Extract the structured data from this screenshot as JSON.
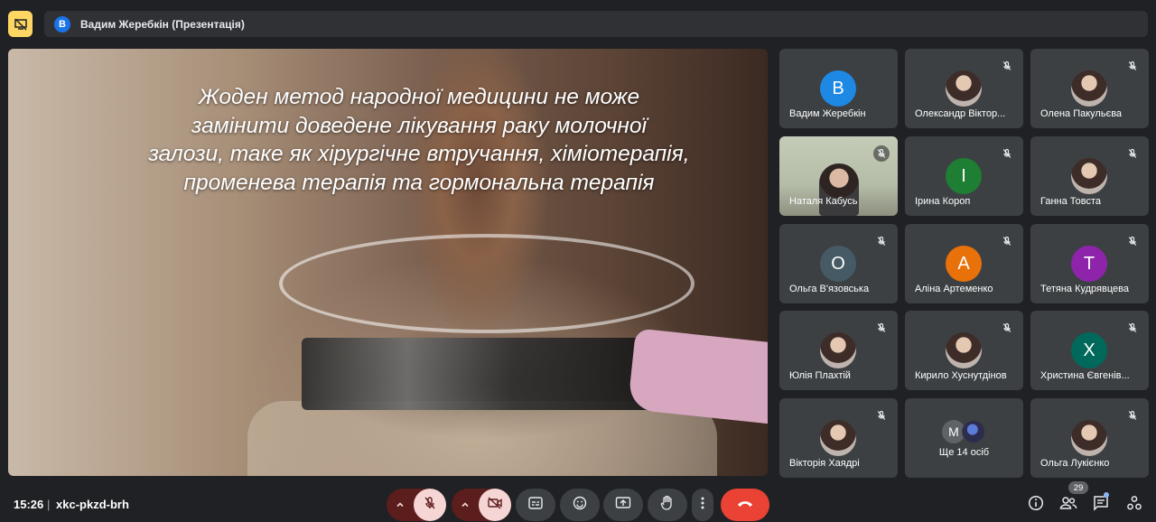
{
  "meeting": {
    "presenter_initial": "В",
    "presenter_title": "Вадим Жеребкін (Презентація)",
    "time": "15:26",
    "separator": "|",
    "code": "xkc-pkzd-brh",
    "people_count": "29"
  },
  "slide": {
    "line1": "Жоден метод народної медицини не може",
    "line2": "замінити доведене лікування раку молочної",
    "line3": "залози, таке як хірургічне втручання, хіміотерапія,",
    "line4": "променева терапія та гормональна терапія"
  },
  "participants": [
    {
      "initial": "В",
      "name": "Вадим Жеребкін",
      "color": "#1e88e5",
      "muted": false
    },
    {
      "initial": "",
      "name": "Олександр Віктор...",
      "muted": true
    },
    {
      "initial": "",
      "name": "Олена Пакульєва",
      "muted": true
    },
    {
      "initial": "",
      "name": "Наталя Кабусь",
      "muted": true,
      "video": true
    },
    {
      "initial": "І",
      "name": "Ірина Короп",
      "color": "#1e7e34",
      "muted": true
    },
    {
      "initial": "",
      "name": "Ганна Товста",
      "muted": true
    },
    {
      "initial": "О",
      "name": "Ольга В'язовська",
      "color": "#455a64",
      "muted": true
    },
    {
      "initial": "А",
      "name": "Аліна Артеменко",
      "color": "#e8710a",
      "muted": true
    },
    {
      "initial": "Т",
      "name": "Тетяна Кудрявцева",
      "color": "#8e24aa",
      "muted": true
    },
    {
      "initial": "",
      "name": "Юлія Плахтій",
      "muted": true
    },
    {
      "initial": "",
      "name": "Кирило Хуснутдінов",
      "muted": true
    },
    {
      "initial": "Х",
      "name": "Христина Євгенів...",
      "color": "#00695c",
      "muted": true
    },
    {
      "initial": "",
      "name": "Вікторія Хаядрі",
      "muted": true
    },
    {
      "initial": "М",
      "name": "Ще 14 осіб",
      "more": true
    },
    {
      "initial": "",
      "name": "Ольга Лукієнко",
      "muted": true
    }
  ],
  "icons": {
    "presenting": "presentation-off-icon",
    "mic": "mic-off-icon",
    "camera": "camera-off-icon",
    "captions": "captions-icon",
    "emoji": "emoji-icon",
    "present": "present-screen-icon",
    "hand": "raise-hand-icon",
    "more": "more-vert-icon",
    "hangup": "call-end-icon",
    "info": "info-icon",
    "people": "people-icon",
    "chat": "chat-icon",
    "activities": "activities-icon"
  },
  "colors": {
    "background": "#202124",
    "tile": "#3c4043",
    "hangup": "#ea4335",
    "muted_button": "#f6d6d4",
    "presenting": "#fdd663"
  }
}
